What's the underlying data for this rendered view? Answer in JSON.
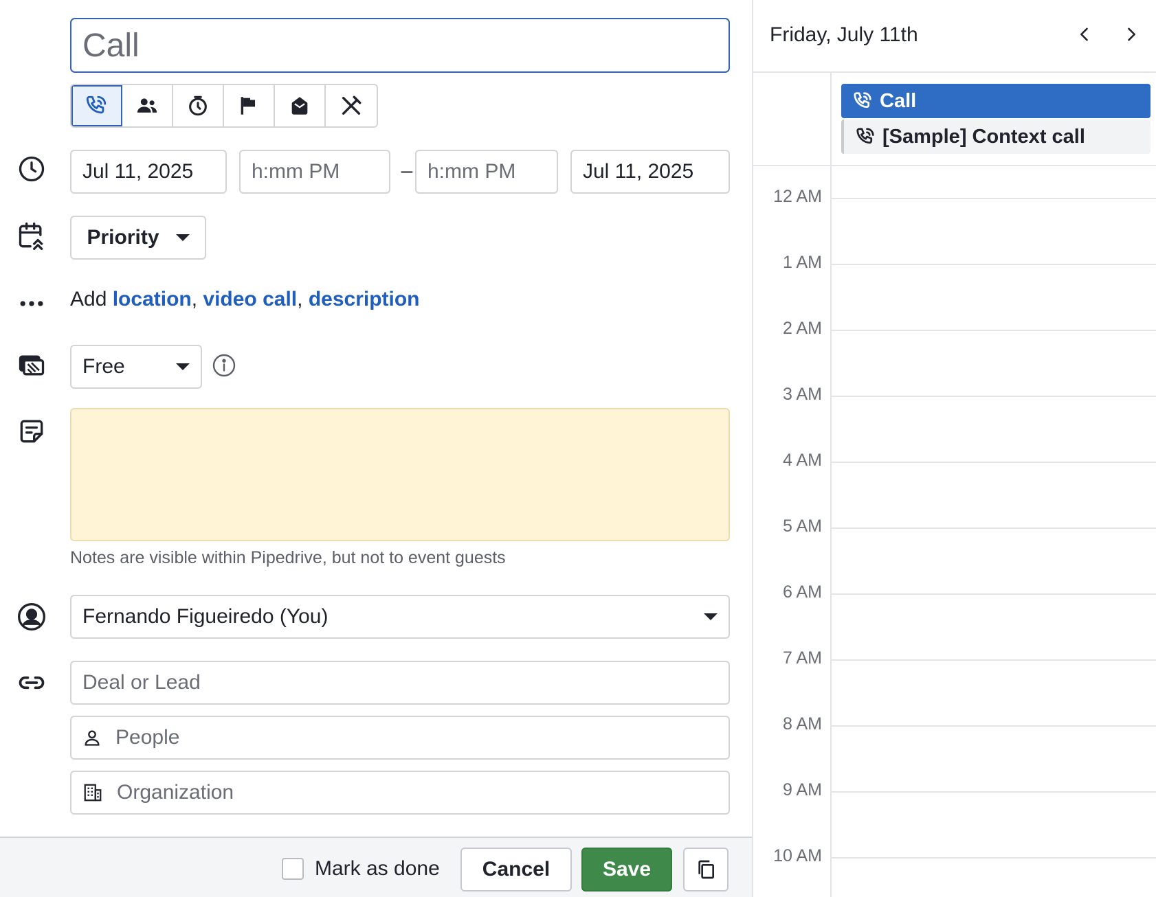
{
  "form": {
    "subject_value": "Call",
    "activity_types": [
      "call",
      "meeting",
      "task",
      "deadline",
      "email",
      "lunch"
    ],
    "active_type": "call",
    "start_date": "Jul 11, 2025",
    "start_time_placeholder": "h:mm PM",
    "time_separator": "–",
    "end_time_placeholder": "h:mm PM",
    "end_date": "Jul 11, 2025",
    "priority_label": "Priority",
    "add_prefix": "Add ",
    "add_links": {
      "location": "location",
      "video_call": "video call",
      "description": "description"
    },
    "add_separator": ", ",
    "busy_status": "Free",
    "notes_hint": "Notes are visible within Pipedrive, but not to event guests",
    "owner": "Fernando Figueiredo (You)",
    "deal_placeholder": "Deal or Lead",
    "people_placeholder": "People",
    "organization_placeholder": "Organization"
  },
  "footer": {
    "mark_done_label": "Mark as done",
    "mark_done_checked": false,
    "cancel_label": "Cancel",
    "save_label": "Save"
  },
  "calendar": {
    "date_title": "Friday, July 11th",
    "events": [
      {
        "title": "Call",
        "highlighted": true
      },
      {
        "title": "[Sample] Context call",
        "highlighted": false
      }
    ],
    "hours": [
      "12 AM",
      "1 AM",
      "2 AM",
      "3 AM",
      "4 AM",
      "5 AM",
      "6 AM",
      "7 AM",
      "8 AM",
      "9 AM",
      "10 AM"
    ]
  },
  "colors": {
    "accent": "#1f5ebd",
    "save_green": "#3f8a4a",
    "notes_bg": "#fff4d6",
    "event_blue": "#2f6cc4"
  }
}
